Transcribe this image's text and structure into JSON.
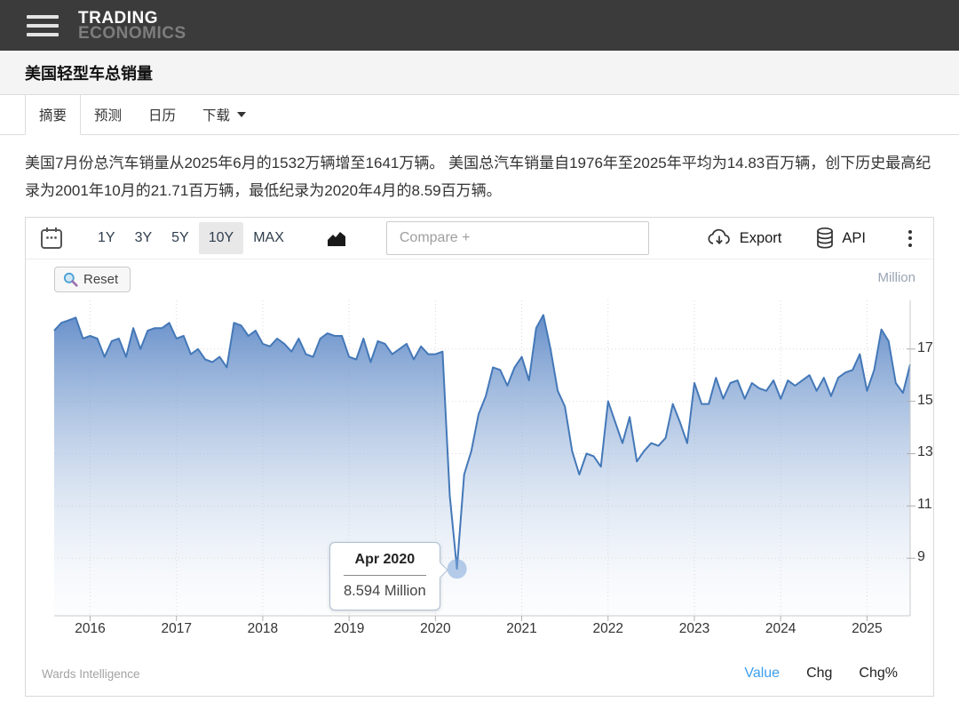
{
  "header": {
    "brand_line1": "TRADING",
    "brand_line2": "ECONOMICS"
  },
  "page_title": "美国轻型车总销量",
  "tabs": [
    {
      "label": "摘要",
      "active": true,
      "has_dropdown": false
    },
    {
      "label": "预测",
      "active": false,
      "has_dropdown": false
    },
    {
      "label": "日历",
      "active": false,
      "has_dropdown": false
    },
    {
      "label": "下载",
      "active": false,
      "has_dropdown": true
    }
  ],
  "summary_text": "美国7月份总汽车销量从2025年6月的1532万辆增至1641万辆。 美国总汽车销量自1976年至2025年平均为14.83百万辆，创下历史最高纪录为2001年10月的21.71百万辆，最低纪录为2020年4月的8.59百万辆。",
  "toolbar": {
    "ranges": [
      "1Y",
      "3Y",
      "5Y",
      "10Y",
      "MAX"
    ],
    "active_range": "10Y",
    "compare_placeholder": "Compare +",
    "export_label": "Export",
    "api_label": "API"
  },
  "chart": {
    "reset_label": "Reset",
    "unit_label": "Million",
    "tooltip": {
      "title": "Apr 2020",
      "value": "8.594 Million"
    }
  },
  "chart_data": {
    "type": "area",
    "title": "美国轻型车总销量 (US Total Vehicle Sales)",
    "unit": "Million",
    "frequency": "monthly",
    "x_start": "2015-08",
    "x_end": "2025-07",
    "monthly_values": [
      17.7,
      18.0,
      18.1,
      18.2,
      17.4,
      17.5,
      17.4,
      16.7,
      17.3,
      17.4,
      16.7,
      17.8,
      17.0,
      17.7,
      17.8,
      17.8,
      18.0,
      17.4,
      17.5,
      16.8,
      17.0,
      16.6,
      16.5,
      16.7,
      16.3,
      18.0,
      17.9,
      17.5,
      17.7,
      17.2,
      17.1,
      17.4,
      17.2,
      16.9,
      17.4,
      16.8,
      16.7,
      17.4,
      17.6,
      17.5,
      17.5,
      16.7,
      16.6,
      17.4,
      16.5,
      17.3,
      17.2,
      16.8,
      17.0,
      17.2,
      16.6,
      17.1,
      16.8,
      16.8,
      16.9,
      11.4,
      8.594,
      12.2,
      13.1,
      14.5,
      15.2,
      16.3,
      16.2,
      15.6,
      16.3,
      16.7,
      15.8,
      17.8,
      18.3,
      17.0,
      15.4,
      14.8,
      13.1,
      12.2,
      13.0,
      12.9,
      12.5,
      15.0,
      14.2,
      13.4,
      14.4,
      12.7,
      13.1,
      13.4,
      13.3,
      13.6,
      14.9,
      14.2,
      13.4,
      15.7,
      14.9,
      14.9,
      15.9,
      15.1,
      15.7,
      15.8,
      15.1,
      15.7,
      15.5,
      15.4,
      15.8,
      15.1,
      15.8,
      15.6,
      15.8,
      16.0,
      15.4,
      15.9,
      15.2,
      15.9,
      16.1,
      16.2,
      16.8,
      15.4,
      16.2,
      17.75,
      17.3,
      15.7,
      15.32,
      16.41
    ],
    "xticks": [
      2016,
      2017,
      2018,
      2019,
      2020,
      2021,
      2022,
      2023,
      2024,
      2025
    ],
    "yticks": [
      17,
      15,
      13,
      11,
      9
    ],
    "ylim": [
      6.8,
      18.86
    ],
    "grid": true,
    "legend": false,
    "highlight": {
      "x": "2020-04",
      "value": 8.594
    },
    "colors": {
      "line": "#4478b8",
      "fill_top": "#5f8ac7",
      "fill_bottom": "#eef3f9",
      "marker": "#7ea6d8"
    }
  },
  "footer": {
    "source": "Wards Intelligence",
    "links": [
      {
        "label": "Value",
        "active": true
      },
      {
        "label": "Chg",
        "active": false
      },
      {
        "label": "Chg%",
        "active": false
      }
    ]
  }
}
